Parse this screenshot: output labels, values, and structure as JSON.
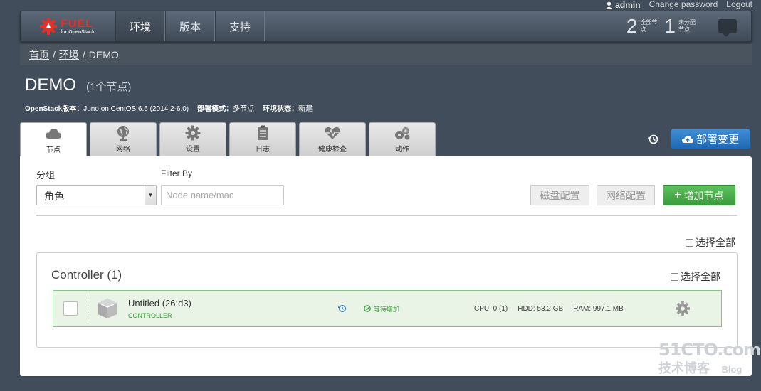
{
  "userbar": {
    "username": "admin",
    "change_password": "Change password",
    "logout": "Logout"
  },
  "navbar": {
    "logo": {
      "name": "FUEL",
      "subtitle": "for OpenStack"
    },
    "items": [
      {
        "label": "环境",
        "active": true
      },
      {
        "label": "版本",
        "active": false
      },
      {
        "label": "支持",
        "active": false
      }
    ],
    "stats": [
      {
        "count": "2",
        "label": "全部节点"
      },
      {
        "count": "1",
        "label": "未分配节点"
      }
    ]
  },
  "breadcrumb": {
    "home": "首页",
    "env": "环境",
    "current": "DEMO"
  },
  "cluster": {
    "name": "DEMO",
    "node_count_text": "(1个节点)",
    "meta": [
      {
        "label": "OpenStack版本：",
        "value": "Juno on CentOS 6.5 (2014.2-6.0)"
      },
      {
        "label": "部署模式：",
        "value": "多节点"
      },
      {
        "label": "环境状态：",
        "value": "新建"
      }
    ]
  },
  "tabs": [
    {
      "label": "节点",
      "icon": "cloud-icon",
      "active": true
    },
    {
      "label": "网络",
      "icon": "globe-icon",
      "active": false
    },
    {
      "label": "设置",
      "icon": "gear-icon",
      "active": false
    },
    {
      "label": "日志",
      "icon": "clipboard-icon",
      "active": false
    },
    {
      "label": "健康检查",
      "icon": "heart-pulse-icon",
      "active": false
    },
    {
      "label": "动作",
      "icon": "gears-icon",
      "active": false
    }
  ],
  "deploy_label": "部署变更",
  "toolbar": {
    "group_label": "分组",
    "group_value": "角色",
    "filter_label": "Filter By",
    "filter_placeholder": "Node name/mac",
    "disk_config": "磁盘配置",
    "network_config": "网络配置",
    "add_nodes": "增加节点"
  },
  "select_all": "选择全部",
  "group": {
    "title": "Controller (1)",
    "select_all": "选择全部",
    "nodes": [
      {
        "name": "Untitled (26:d3)",
        "role": "CONTROLLER",
        "status": "等待增加",
        "cpu": "CPU: 0 (1)",
        "hdd": "HDD: 53.2 GB",
        "ram": "RAM: 997.1 MB"
      }
    ]
  },
  "watermark": {
    "site": "51CTO.com",
    "sub": "技术博客",
    "blog": "Blog"
  }
}
